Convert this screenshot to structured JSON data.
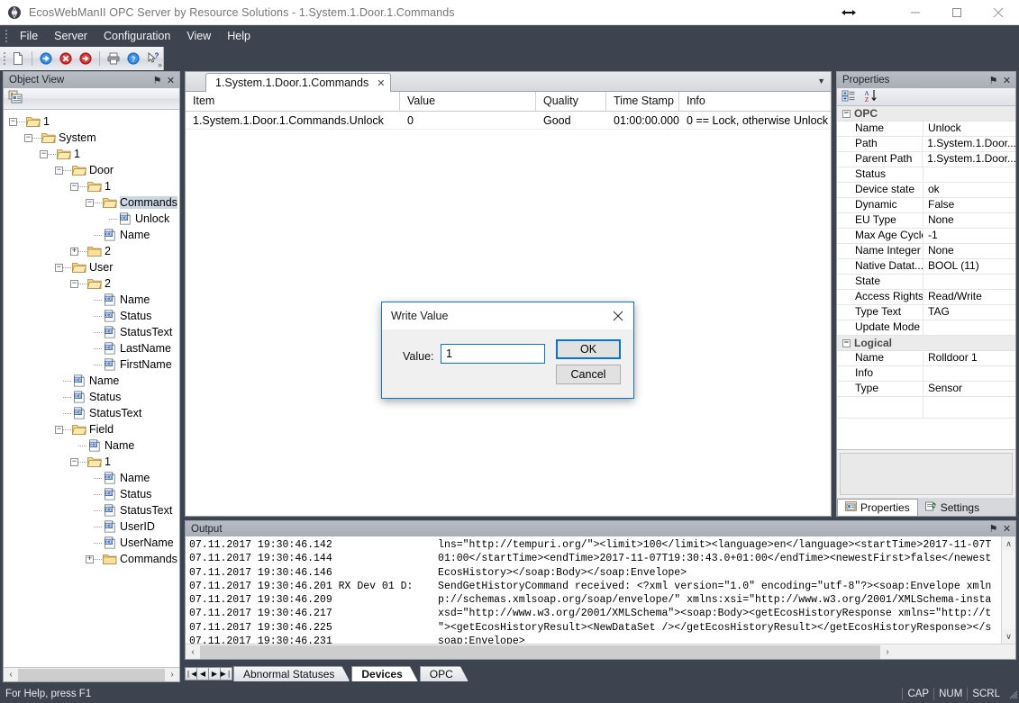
{
  "window": {
    "title": "EcosWebManII OPC Server by Resource Solutions - 1.System.1.Door.1.Commands",
    "app_icon": "diamond-icon",
    "resize_cursor_icon": "horizontal-resize-icon",
    "minimize_label": "—",
    "maximize_label": "□",
    "close_label": "✕"
  },
  "menubar": {
    "items": [
      {
        "label": "File"
      },
      {
        "label": "Server"
      },
      {
        "label": "Configuration"
      },
      {
        "label": "View"
      },
      {
        "label": "Help"
      }
    ]
  },
  "toolbar": {
    "buttons": [
      {
        "name": "new-document-icon"
      },
      {
        "name": "connect-icon"
      },
      {
        "name": "disconnect-error-icon"
      },
      {
        "name": "reconnect-icon"
      },
      {
        "name": "print-icon"
      },
      {
        "name": "help-icon"
      },
      {
        "name": "context-help-icon"
      }
    ],
    "overflow_label": "»"
  },
  "object_view": {
    "title": "Object View",
    "pin_label": "⚑",
    "close_label": "✕",
    "toolbar_icon": "object-list-icon",
    "hscroll": {
      "left_label": "‹",
      "right_label": "›"
    },
    "tree": [
      {
        "depth": 0,
        "toggle": "minus",
        "icon": "folder-open-icon",
        "label": "1"
      },
      {
        "depth": 1,
        "toggle": "minus",
        "icon": "folder-open-icon",
        "label": "System"
      },
      {
        "depth": 2,
        "toggle": "minus",
        "icon": "folder-open-icon",
        "label": "1"
      },
      {
        "depth": 3,
        "toggle": "minus",
        "icon": "folder-open-icon",
        "label": "Door"
      },
      {
        "depth": 4,
        "toggle": "minus",
        "icon": "folder-open-icon",
        "label": "1"
      },
      {
        "depth": 5,
        "toggle": "minus",
        "icon": "folder-open-icon",
        "label": "Commands",
        "selected": true
      },
      {
        "depth": 6,
        "toggle": "none",
        "icon": "tag-icon",
        "label": "Unlock"
      },
      {
        "depth": 5,
        "toggle": "none",
        "icon": "tag-icon",
        "label": "Name"
      },
      {
        "depth": 4,
        "toggle": "plus",
        "icon": "folder-closed-icon",
        "label": "2"
      },
      {
        "depth": 3,
        "toggle": "minus",
        "icon": "folder-open-icon",
        "label": "User"
      },
      {
        "depth": 4,
        "toggle": "minus",
        "icon": "folder-open-icon",
        "label": "2"
      },
      {
        "depth": 5,
        "toggle": "none",
        "icon": "tag-icon",
        "label": "Name"
      },
      {
        "depth": 5,
        "toggle": "none",
        "icon": "tag-icon",
        "label": "Status"
      },
      {
        "depth": 5,
        "toggle": "none",
        "icon": "tag-icon",
        "label": "StatusText"
      },
      {
        "depth": 5,
        "toggle": "none",
        "icon": "tag-icon",
        "label": "LastName"
      },
      {
        "depth": 5,
        "toggle": "none",
        "icon": "tag-icon",
        "label": "FirstName"
      },
      {
        "depth": 3,
        "toggle": "none",
        "icon": "tag-icon",
        "label": "Name"
      },
      {
        "depth": 3,
        "toggle": "none",
        "icon": "tag-icon",
        "label": "Status"
      },
      {
        "depth": 3,
        "toggle": "none",
        "icon": "tag-icon",
        "label": "StatusText"
      },
      {
        "depth": 3,
        "toggle": "minus",
        "icon": "folder-open-icon",
        "label": "Field"
      },
      {
        "depth": 4,
        "toggle": "none",
        "icon": "tag-icon",
        "label": "Name"
      },
      {
        "depth": 4,
        "toggle": "minus",
        "icon": "folder-open-icon",
        "label": "1"
      },
      {
        "depth": 5,
        "toggle": "none",
        "icon": "tag-icon",
        "label": "Name"
      },
      {
        "depth": 5,
        "toggle": "none",
        "icon": "tag-icon",
        "label": "Status"
      },
      {
        "depth": 5,
        "toggle": "none",
        "icon": "tag-icon",
        "label": "StatusText"
      },
      {
        "depth": 5,
        "toggle": "none",
        "icon": "tag-icon",
        "label": "UserID"
      },
      {
        "depth": 5,
        "toggle": "none",
        "icon": "tag-icon",
        "label": "UserName"
      },
      {
        "depth": 5,
        "toggle": "plus",
        "icon": "folder-closed-icon",
        "label": "Commands"
      }
    ]
  },
  "document": {
    "tab": {
      "label": "1.System.1.Door.1.Commands",
      "close_label": "✕"
    },
    "tab_dropdown_label": "▼",
    "grid": {
      "columns": [
        "Item",
        "Value",
        "Quality",
        "Time Stamp",
        "Info"
      ],
      "rows": [
        {
          "item": "1.System.1.Door.1.Commands.Unlock",
          "value": "0",
          "quality": "Good",
          "timestamp": "01:00:00.000",
          "info": "0 == Lock, otherwise Unlock"
        }
      ]
    }
  },
  "properties": {
    "title": "Properties",
    "pin_label": "⚑",
    "close_label": "✕",
    "toolbar": {
      "categorize_icon": "categorized-view-icon",
      "sort_icon": "alphabetical-sort-icon"
    },
    "groups": [
      {
        "name": "OPC",
        "toggle": "minus",
        "rows": [
          {
            "name": "Name",
            "value": "Unlock"
          },
          {
            "name": "Path",
            "value": "1.System.1.Door..."
          },
          {
            "name": "Parent Path",
            "value": "1.System.1.Door..."
          },
          {
            "name": "Status",
            "value": ""
          },
          {
            "name": "Device state",
            "value": "ok"
          },
          {
            "name": "Dynamic",
            "value": "False"
          },
          {
            "name": "EU Type",
            "value": "None"
          },
          {
            "name": "Max Age Cycle",
            "value": "-1"
          },
          {
            "name": "Name Integer",
            "value": "None"
          },
          {
            "name": "Native Datat...",
            "value": "BOOL (11)"
          },
          {
            "name": "State",
            "value": ""
          },
          {
            "name": "Access Rights",
            "value": "Read/Write"
          },
          {
            "name": "Type Text",
            "value": "TAG"
          },
          {
            "name": "Update Mode",
            "value": ""
          }
        ]
      },
      {
        "name": "Logical",
        "toggle": "minus",
        "rows": [
          {
            "name": "Name",
            "value": "Rolldoor 1"
          },
          {
            "name": "Info",
            "value": ""
          },
          {
            "name": "Type",
            "value": "Sensor"
          }
        ]
      }
    ],
    "tabs": [
      {
        "label": "Properties",
        "icon": "properties-icon",
        "active": true
      },
      {
        "label": "Settings",
        "icon": "settings-icon",
        "active": false
      }
    ]
  },
  "output": {
    "title": "Output",
    "pin_label": "⚑",
    "close_label": "✕",
    "lines": [
      {
        "timestamp": "07.11.2017 19:30:46.142",
        "channel": "",
        "text": "lns=\"http://tempuri.org/\"><limit>100</limit><language>en</language><startTime>2017-11-07T"
      },
      {
        "timestamp": "07.11.2017 19:30:46.144",
        "channel": "",
        "text": "01:00</startTime><endTime>2017-11-07T19:30:43.0+01:00</endTime><newestFirst>false</newest"
      },
      {
        "timestamp": "07.11.2017 19:30:46.146",
        "channel": "",
        "text": "EcosHistory></soap:Body></soap:Envelope>"
      },
      {
        "timestamp": "07.11.2017 19:30:46.201",
        "channel": "RX Dev 01 D:",
        "text": "SendGetHistoryCommand received: <?xml version=\"1.0\" encoding=\"utf-8\"?><soap:Envelope xmln"
      },
      {
        "timestamp": "07.11.2017 19:30:46.209",
        "channel": "",
        "text": "p://schemas.xmlsoap.org/soap/envelope/\" xmlns:xsi=\"http://www.w3.org/2001/XMLSchema-insta"
      },
      {
        "timestamp": "07.11.2017 19:30:46.217",
        "channel": "",
        "text": "xsd=\"http://www.w3.org/2001/XMLSchema\"><soap:Body><getEcosHistoryResponse xmlns=\"http://t"
      },
      {
        "timestamp": "07.11.2017 19:30:46.225",
        "channel": "",
        "text": "\"><getEcosHistoryResult><NewDataSet /></getEcosHistoryResult></getEcosHistoryResponse></s"
      },
      {
        "timestamp": "07.11.2017 19:30:46.231",
        "channel": "",
        "text": "soap:Envelope>"
      }
    ],
    "vscroll": {
      "up_label": "∧",
      "down_label": "∨"
    },
    "hscroll": {
      "left_label": "‹",
      "right_label": "›"
    }
  },
  "bottom_tabs": {
    "nav": [
      {
        "name": "first-record-button",
        "label": "❘◀"
      },
      {
        "name": "previous-record-button",
        "label": "◀"
      },
      {
        "name": "next-record-button",
        "label": "▶"
      },
      {
        "name": "last-record-button",
        "label": "▶❘"
      }
    ],
    "tabs": [
      {
        "label": "Abnormal Statuses",
        "active": false
      },
      {
        "label": "Devices",
        "active": true
      },
      {
        "label": "OPC",
        "active": false
      }
    ]
  },
  "statusbar": {
    "message": "For Help, press F1",
    "indicators": [
      "CAP",
      "NUM",
      "SCRL"
    ]
  },
  "dialog": {
    "title": "Write Value",
    "close_label": "✕",
    "value_label": "Value:",
    "value": "1",
    "value_placeholder": "",
    "ok_label": "OK",
    "cancel_label": "Cancel",
    "accent_color": "#0078d7"
  }
}
